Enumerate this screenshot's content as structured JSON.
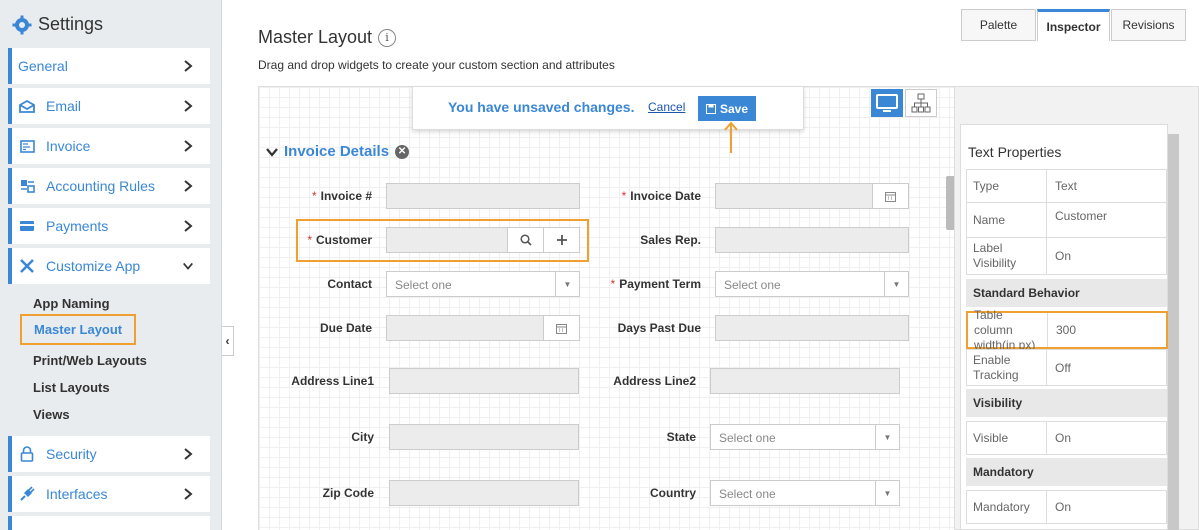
{
  "sidebar": {
    "title": "Settings",
    "items": [
      {
        "label": "General",
        "icon": "none"
      },
      {
        "label": "Email",
        "icon": "envelope-icon"
      },
      {
        "label": "Invoice",
        "icon": "invoice-icon"
      },
      {
        "label": "Accounting Rules",
        "icon": "accounting-icon"
      },
      {
        "label": "Payments",
        "icon": "card-icon"
      },
      {
        "label": "Customize App",
        "icon": "tools-icon"
      },
      {
        "label": "Security",
        "icon": "lock-icon"
      },
      {
        "label": "Interfaces",
        "icon": "plug-icon"
      }
    ],
    "sub_items": [
      "App Naming",
      "Master Layout",
      "Print/Web Layouts",
      "List Layouts",
      "Views"
    ]
  },
  "main": {
    "title": "Master Layout",
    "subtitle": "Drag and drop widgets to create your custom section and attributes"
  },
  "unsaved_bar": {
    "message": "You have unsaved changes.",
    "cancel": "Cancel",
    "save": "Save"
  },
  "section": {
    "title": "Invoice Details"
  },
  "fields": {
    "invoice_no": "Invoice #",
    "invoice_date": "Invoice Date",
    "customer": "Customer",
    "sales_rep": "Sales Rep.",
    "contact": "Contact",
    "payment_term": "Payment Term",
    "due_date": "Due Date",
    "days_past_due": "Days Past Due",
    "address1": "Address Line1",
    "address2": "Address Line2",
    "city": "City",
    "state": "State",
    "zip": "Zip Code",
    "country": "Country",
    "select_placeholder": "Select one"
  },
  "panel": {
    "tabs": [
      "Palette",
      "Inspector",
      "Revisions"
    ],
    "section_title": "Text Properties",
    "rows": [
      {
        "k": "Type",
        "v": "Text"
      },
      {
        "k": "Name",
        "v": "Customer"
      },
      {
        "k": "Label Visibility",
        "v": "On"
      }
    ],
    "group_standard": "Standard Behavior",
    "rows2": [
      {
        "k": "Table column width(in px)",
        "v": "300"
      },
      {
        "k": "Enable Tracking",
        "v": "Off"
      }
    ],
    "group_visibility": "Visibility",
    "visible": {
      "k": "Visible",
      "v": "On"
    },
    "group_mandatory": "Mandatory",
    "mandatory": {
      "k": "Mandatory",
      "v": "On"
    }
  },
  "colors": {
    "accent": "#3a87d6",
    "highlight": "#f0a030"
  }
}
